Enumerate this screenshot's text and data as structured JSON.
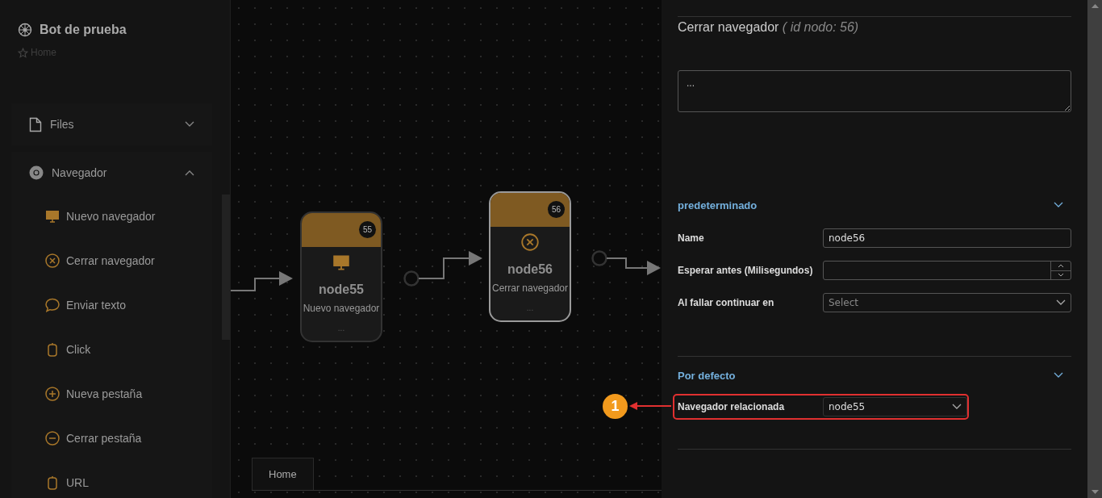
{
  "sidebar": {
    "title": "Bot de prueba",
    "breadcrumb": "Home",
    "groups": [
      {
        "label": "Files",
        "kind": "file",
        "expanded": false
      },
      {
        "label": "Navegador",
        "kind": "browser",
        "expanded": true,
        "items": [
          {
            "label": "Nuevo navegador",
            "kind": "monitor"
          },
          {
            "label": "Cerrar navegador",
            "kind": "close"
          },
          {
            "label": "Enviar texto",
            "kind": "chat"
          },
          {
            "label": "Click",
            "kind": "mouse"
          },
          {
            "label": "Nueva pestaña",
            "kind": "plus"
          },
          {
            "label": "Cerrar pestaña",
            "kind": "minus"
          },
          {
            "label": "URL",
            "kind": "mouse"
          }
        ]
      }
    ]
  },
  "canvas": {
    "nodes": [
      {
        "badge": "55",
        "name": "node55",
        "label": "Nuevo navegador",
        "footer": "...",
        "kind": "monitor",
        "selected": false
      },
      {
        "badge": "56",
        "name": "node56",
        "label": "Cerrar navegador",
        "footer": "...",
        "kind": "close",
        "selected": true
      }
    ],
    "tabs": [
      {
        "label": "Home",
        "selected": true
      }
    ]
  },
  "panel": {
    "title": "Cerrar navegador",
    "subtitle": "( id nodo: 56)",
    "description": "...",
    "sections": [
      {
        "title": "predeterminado",
        "fields": [
          {
            "label": "Name",
            "kind": "text",
            "value": "node56"
          },
          {
            "label": "Esperar antes (Milisegundos)",
            "kind": "number"
          },
          {
            "label": "Al fallar continuar en",
            "kind": "select",
            "placeholder": "Select"
          }
        ]
      },
      {
        "title": "Por defecto",
        "fields": [
          {
            "label": "Navegador relacionada",
            "kind": "select",
            "value": "node55",
            "highlighted": true
          }
        ]
      }
    ],
    "callout": "1"
  }
}
